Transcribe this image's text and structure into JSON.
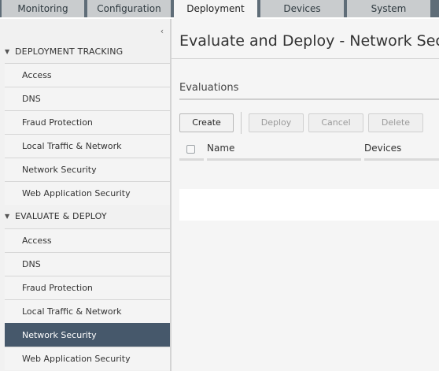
{
  "tabs": [
    {
      "label": "Monitoring"
    },
    {
      "label": "Configuration"
    },
    {
      "label": "Deployment",
      "active": true
    },
    {
      "label": "Devices"
    },
    {
      "label": "System"
    }
  ],
  "sidebar": {
    "collapse_icon": "chevron-left-icon",
    "sections": [
      {
        "label": "DEPLOYMENT TRACKING",
        "expanded": true,
        "items": [
          {
            "label": "Access"
          },
          {
            "label": "DNS"
          },
          {
            "label": "Fraud Protection"
          },
          {
            "label": "Local Traffic & Network"
          },
          {
            "label": "Network Security"
          },
          {
            "label": "Web Application Security"
          }
        ]
      },
      {
        "label": "EVALUATE & DEPLOY",
        "expanded": true,
        "items": [
          {
            "label": "Access"
          },
          {
            "label": "DNS"
          },
          {
            "label": "Fraud Protection"
          },
          {
            "label": "Local Traffic & Network"
          },
          {
            "label": "Network Security",
            "selected": true
          },
          {
            "label": "Web Application Security"
          }
        ]
      }
    ]
  },
  "main": {
    "title": "Evaluate and Deploy - Network Security",
    "evaluations": {
      "title": "Evaluations",
      "buttons": {
        "create": "Create",
        "deploy": "Deploy",
        "cancel": "Cancel",
        "delete": "Delete"
      },
      "columns": {
        "name": "Name",
        "devices": "Devices"
      }
    }
  },
  "colors": {
    "topbar_bg": "#5f6d78",
    "tab_bg": "#c9ccce",
    "selected_item_bg": "#46586b",
    "panel_bg": "#f5f5f5"
  }
}
